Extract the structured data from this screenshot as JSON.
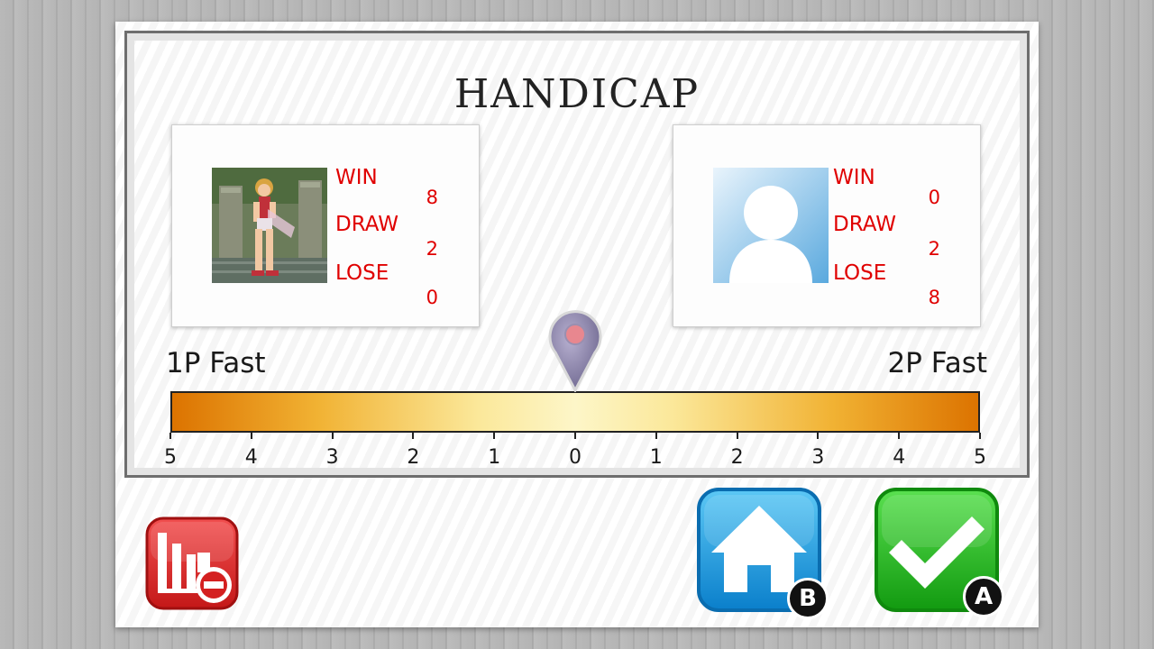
{
  "title": "HANDICAP",
  "players": [
    {
      "id": "1p",
      "win_label": "WIN",
      "win": "8",
      "draw_label": "DRAW",
      "draw": "2",
      "lose_label": "LOSE",
      "lose": "0"
    },
    {
      "id": "2p",
      "win_label": "WIN",
      "win": "0",
      "draw_label": "DRAW",
      "draw": "2",
      "lose_label": "LOSE",
      "lose": "8"
    }
  ],
  "slider": {
    "left_label": "1P Fast",
    "right_label": "2P Fast",
    "ticks": [
      "5",
      "4",
      "3",
      "2",
      "1",
      "0",
      "1",
      "2",
      "3",
      "4",
      "5"
    ],
    "value": 0
  },
  "buttons": {
    "home_key": "B",
    "confirm_key": "A"
  },
  "colors": {
    "stat_text": "#e00000",
    "bar_edge": "#dc7300",
    "bar_center": "#fdf6c8",
    "home_blue": "#1a9fe0",
    "confirm_green": "#22b61c",
    "stats_red": "#d82020",
    "pin_purple": "#8a83a8"
  },
  "icons": {
    "stats_button": "bar-chart-minus-icon",
    "home_button": "home-icon",
    "confirm_button": "checkmark-icon",
    "default_avatar": "user-silhouette-icon",
    "slider_marker": "map-pin-icon"
  }
}
